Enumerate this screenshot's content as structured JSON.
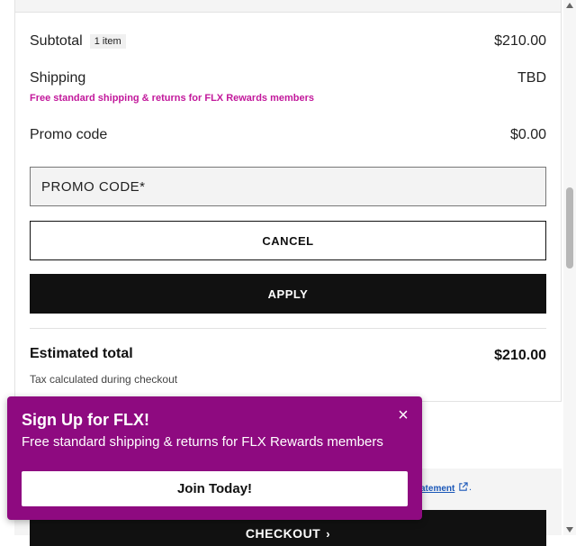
{
  "summary": {
    "subtotal_label": "Subtotal",
    "item_count": "1 item",
    "subtotal_value": "$210.00",
    "shipping_label": "Shipping",
    "shipping_value": "TBD",
    "shipping_promo": "Free standard shipping & returns for FLX Rewards members",
    "promo_label": "Promo code",
    "promo_value": "$0.00"
  },
  "promo_form": {
    "placeholder": "PROMO CODE*",
    "cancel_label": "CANCEL",
    "apply_label": "APPLY"
  },
  "total": {
    "label": "Estimated total",
    "value": "$210.00",
    "tax_note": "Tax calculated during checkout"
  },
  "footer": {
    "privacy_link": "atement",
    "period": ".",
    "checkout_label": "CHECKOUT",
    "checkout_chevron": "›"
  },
  "popup": {
    "title": "Sign Up for FLX!",
    "subtitle": "Free standard shipping & returns for FLX Rewards members",
    "button_label": "Join Today!",
    "close_glyph": "×"
  },
  "colors": {
    "accent": "#8e0a80",
    "promo_text": "#c2189b",
    "primary_button": "#111111",
    "link": "#1a57b8"
  }
}
